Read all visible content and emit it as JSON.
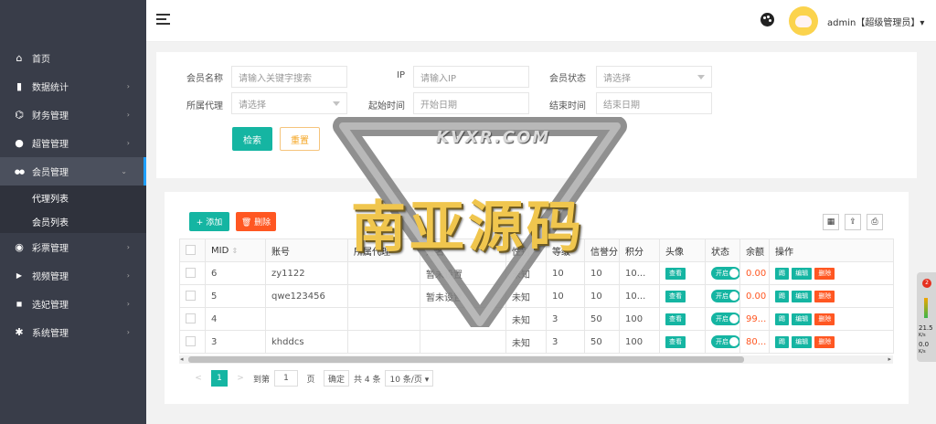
{
  "sidebar": {
    "items": [
      {
        "label": "首页",
        "icon": "home-icon",
        "glyph": "⌂"
      },
      {
        "label": "数据统计",
        "icon": "bar-chart-icon",
        "glyph": "▮"
      },
      {
        "label": "财务管理",
        "icon": "bank-icon",
        "glyph": "⌬"
      },
      {
        "label": "超管管理",
        "icon": "user-icon",
        "glyph": "●"
      },
      {
        "label": "会员管理",
        "icon": "users-icon",
        "glyph": "●●"
      }
    ],
    "sub_items": [
      {
        "label": "代理列表"
      },
      {
        "label": "会员列表"
      }
    ],
    "items_after": [
      {
        "label": "彩票管理",
        "icon": "gamepad-icon",
        "glyph": "◉"
      },
      {
        "label": "视频管理",
        "icon": "video-icon",
        "glyph": "▶"
      },
      {
        "label": "选妃管理",
        "icon": "camera-icon",
        "glyph": "◼"
      },
      {
        "label": "系统管理",
        "icon": "gear-icon",
        "glyph": "✱"
      }
    ]
  },
  "header": {
    "user": "admin【超级管理员】▾"
  },
  "filters": {
    "member_name_label": "会员名称",
    "member_name_placeholder": "请输入关键字搜索",
    "ip_label": "IP",
    "ip_placeholder": "请输入IP",
    "status_label": "会员状态",
    "status_placeholder": "请选择",
    "agent_label": "所属代理",
    "agent_placeholder": "请选择",
    "start_label": "起始时间",
    "start_placeholder": "开始日期",
    "end_label": "结束时间",
    "end_placeholder": "结束日期",
    "search_button": "检索",
    "reset_button": "重置"
  },
  "toolbar": {
    "add_button": "+ 添加",
    "delete_button": "🗑 删除"
  },
  "table": {
    "columns": [
      "",
      "MID",
      "账号",
      "所属代理",
      "姓名",
      "性别",
      "等级",
      "信誉分",
      "积分",
      "头像",
      "状态",
      "余额",
      "操作"
    ],
    "rows": [
      {
        "mid": "6",
        "account": "zy1122",
        "agent": "",
        "name": "暂未设置",
        "gender": "未知",
        "level": "10",
        "credit": "10",
        "points": "10...",
        "balance": "0.00"
      },
      {
        "mid": "5",
        "account": "qwe123456",
        "agent": "",
        "name": "暂未设置",
        "gender": "未知",
        "level": "10",
        "credit": "10",
        "points": "10...",
        "balance": "0.00"
      },
      {
        "mid": "4",
        "account": "",
        "agent": "",
        "name": "",
        "gender": "未知",
        "level": "3",
        "credit": "50",
        "points": "100",
        "balance": "99..."
      },
      {
        "mid": "3",
        "account": "khddcs",
        "agent": "",
        "name": "",
        "gender": "未知",
        "level": "3",
        "credit": "50",
        "points": "100",
        "balance": "80..."
      }
    ],
    "view_label": "查看",
    "switch_label": "开启",
    "op_labels": [
      "踢",
      "编辑",
      "删除"
    ]
  },
  "pager": {
    "prev": "<",
    "current": "1",
    "next": ">",
    "goto_label": "到第",
    "goto_value": "1",
    "page_unit": "页",
    "confirm": "确定",
    "total": "共 4 条",
    "per_page": "10 条/页 ▾"
  },
  "speed_widget": {
    "badge": "2",
    "up": "21.5",
    "down": "0.0",
    "unit": "K/s"
  },
  "watermark": {
    "main": "南亚源码",
    "sub": "KVXR.COM"
  }
}
